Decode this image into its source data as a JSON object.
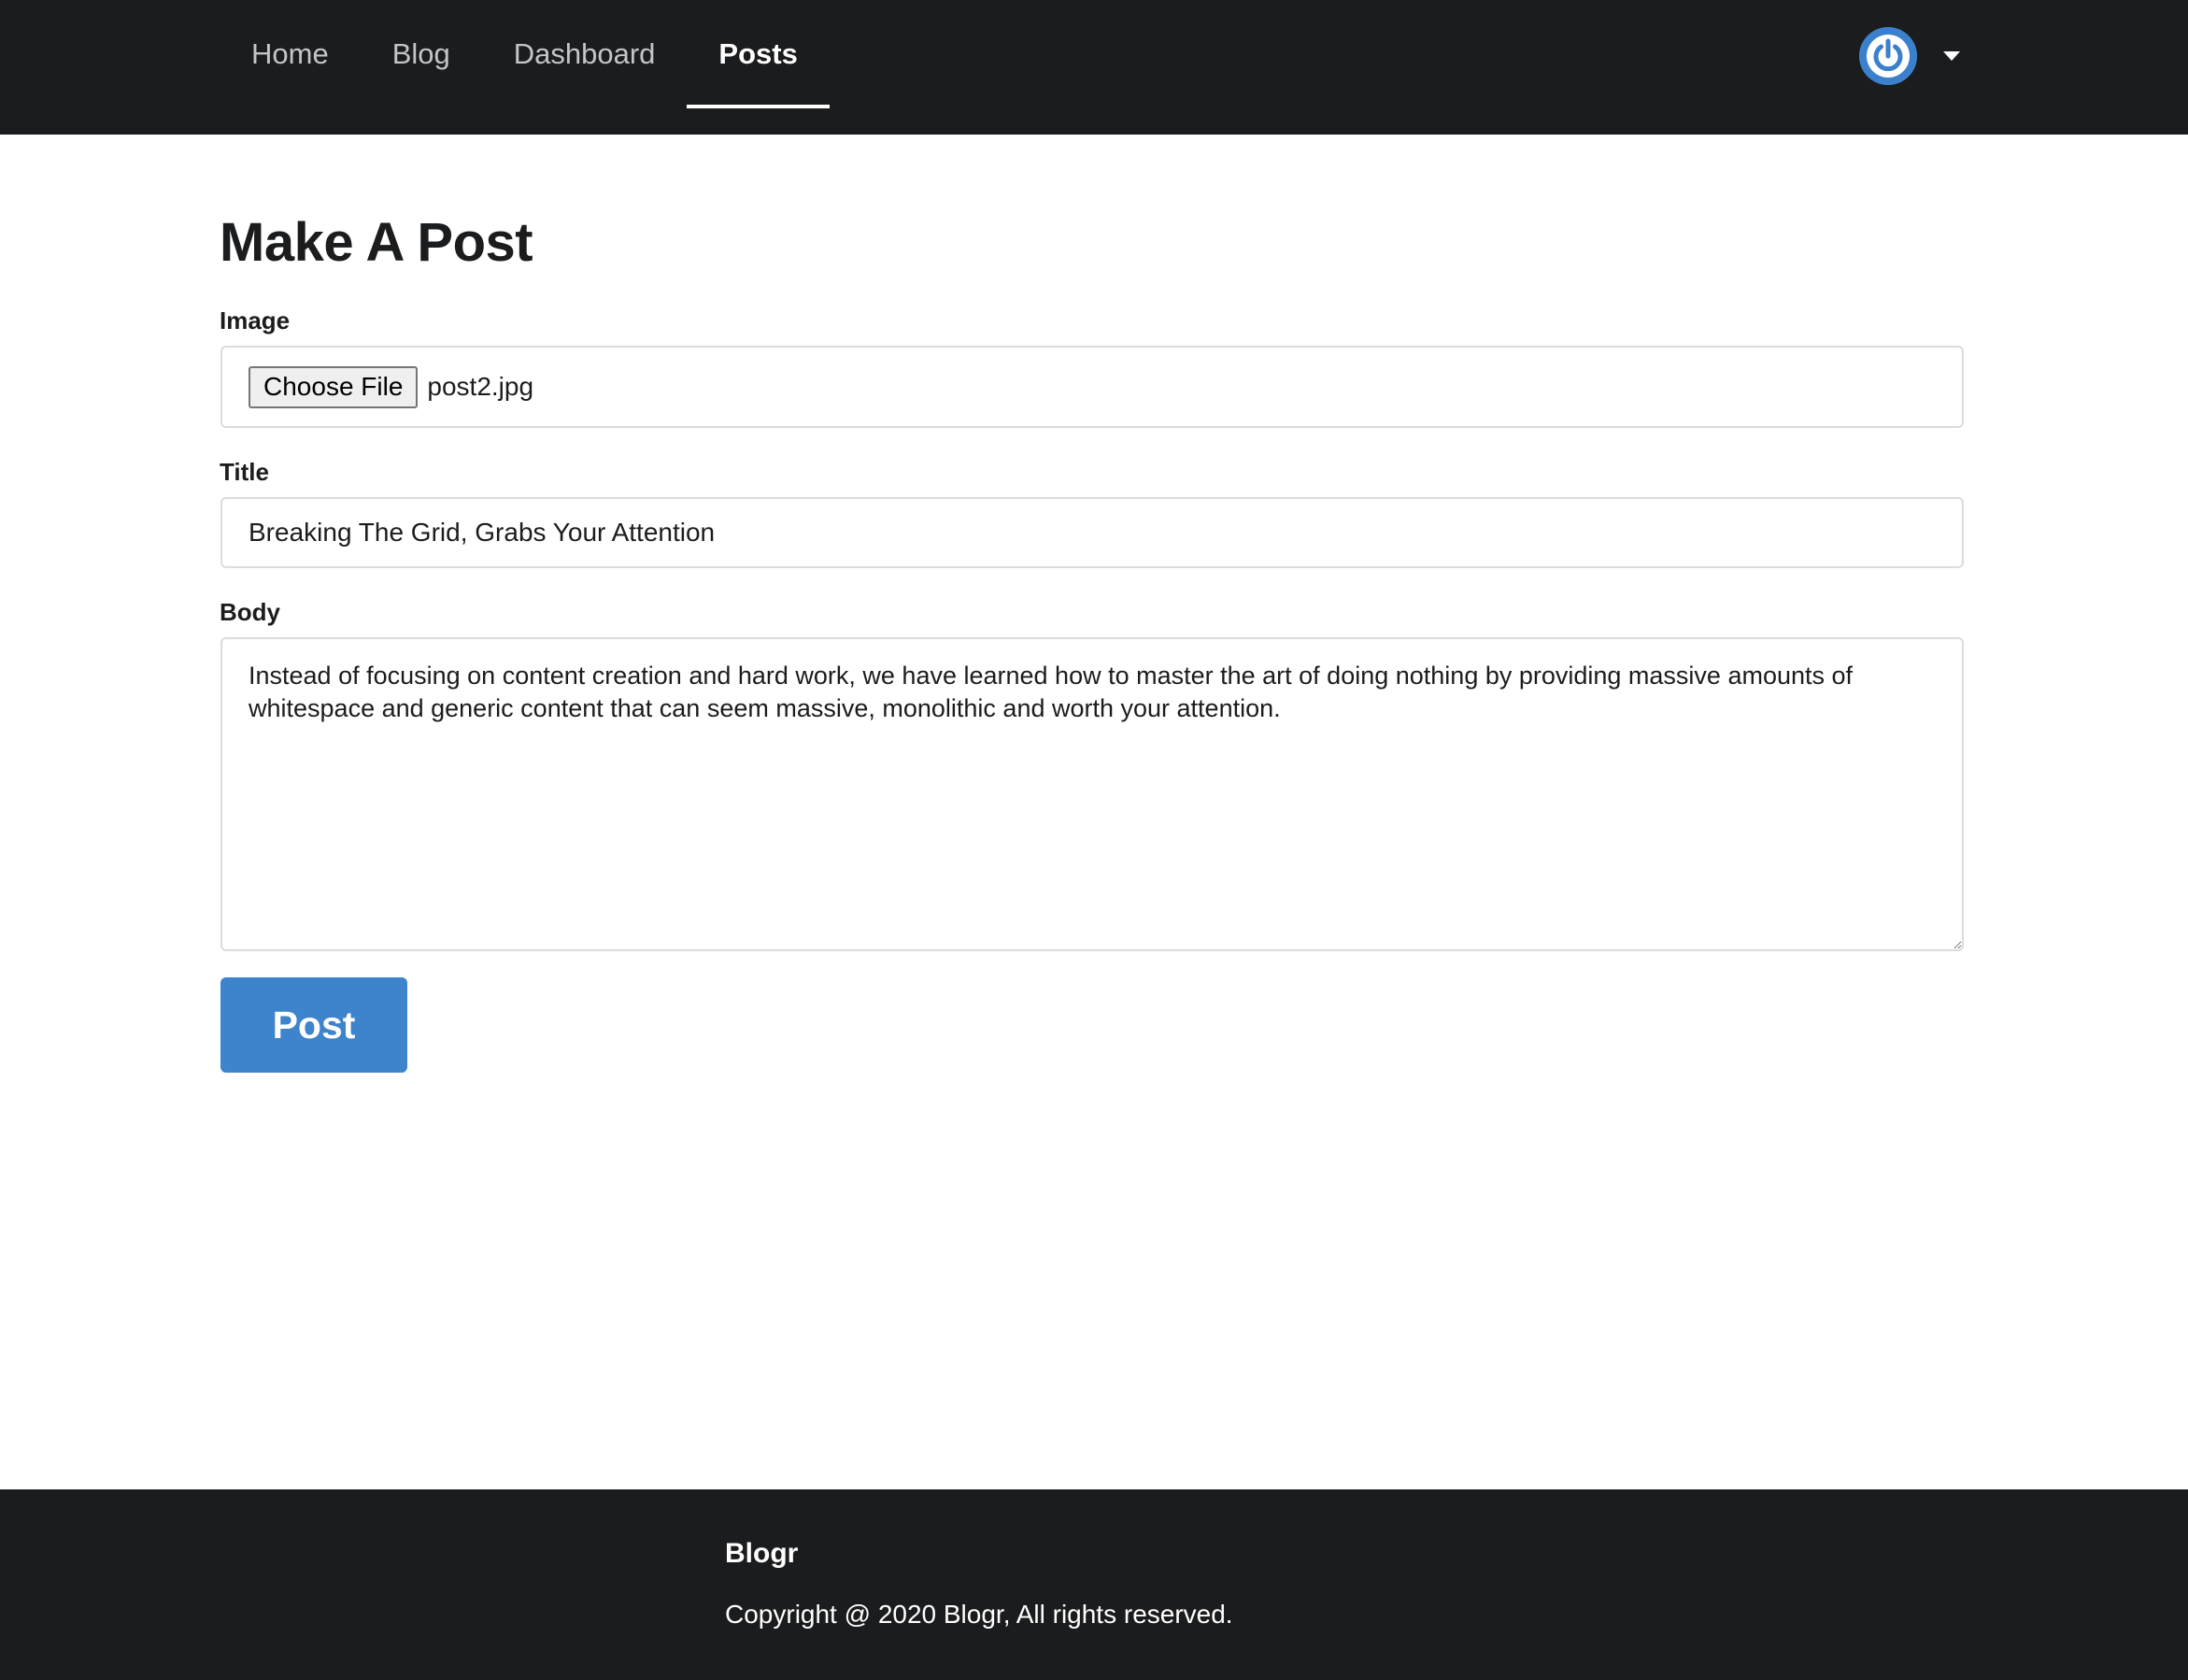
{
  "nav": {
    "links": [
      {
        "label": "Home",
        "active": false
      },
      {
        "label": "Blog",
        "active": false
      },
      {
        "label": "Dashboard",
        "active": false
      },
      {
        "label": "Posts",
        "active": true
      }
    ],
    "avatar_icon": "power-icon",
    "dropdown_icon": "caret-down-icon"
  },
  "form": {
    "title": "Make A Post",
    "image": {
      "label": "Image",
      "button_label": "Choose File",
      "file_name": "post2.jpg"
    },
    "post_title": {
      "label": "Title",
      "value": "Breaking The Grid, Grabs Your Attention"
    },
    "body": {
      "label": "Body",
      "value": "Instead of focusing on content creation and hard work, we have learned how to master the art of doing nothing by providing massive amounts of whitespace and generic content that can seem massive, monolithic and worth your attention."
    },
    "submit_label": "Post"
  },
  "footer": {
    "brand": "Blogr",
    "copyright": "Copyright @ 2020 Blogr, All rights reserved."
  },
  "colors": {
    "nav_bg": "#1b1c1e",
    "accent": "#3d84cc",
    "footer_bg": "#1b1c1e"
  }
}
